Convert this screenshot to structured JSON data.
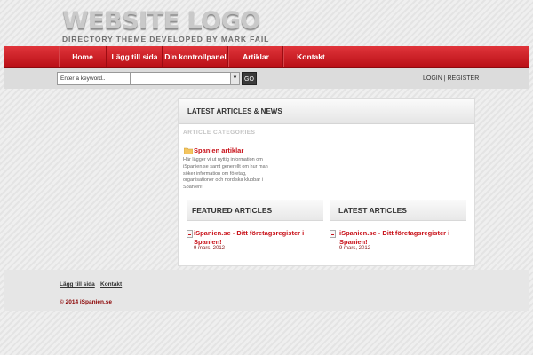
{
  "header": {
    "logo": "WEBSITE LOGO",
    "tagline": "DIRECTORY THEME DEVELOPED BY MARK FAIL"
  },
  "nav": {
    "items": [
      {
        "label": "Home"
      },
      {
        "label": "Lägg till sida"
      },
      {
        "label": "Din kontrollpanel"
      },
      {
        "label": "Artiklar"
      },
      {
        "label": "Kontakt"
      }
    ]
  },
  "search": {
    "keyword_value": "Enter a keyword..",
    "category_value": "",
    "go_label": "GO",
    "auth_links": "LOGIN | REGISTER"
  },
  "main": {
    "panel_title": "LATEST ARTICLES & NEWS",
    "category_heading": "ARTICLE CATEGORIES",
    "category": {
      "name": "Spanien artiklar",
      "description": "Här lägger vi ut nyttig information om iSpanien.se samt generellt om hur man söker information om företag, organisationer och nordiska klubbar i Spanien!"
    },
    "featured": {
      "title": "FEATURED ARTICLES",
      "article_title": "iSpanien.se - Ditt företagsregister i Spanien!",
      "article_date": "9 mars, 2012"
    },
    "latest": {
      "title": "LATEST ARTICLES",
      "article_title": "iSpanien.se - Ditt företagsregister i Spanien!",
      "article_date": "9 mars, 2012"
    }
  },
  "footer": {
    "links": [
      {
        "label": "Lägg till sida"
      },
      {
        "label": "Kontakt"
      }
    ],
    "copyright": "© 2014 iSpanien.se"
  },
  "colors": {
    "accent": "#c81018",
    "nav_red": "#d4242b"
  }
}
